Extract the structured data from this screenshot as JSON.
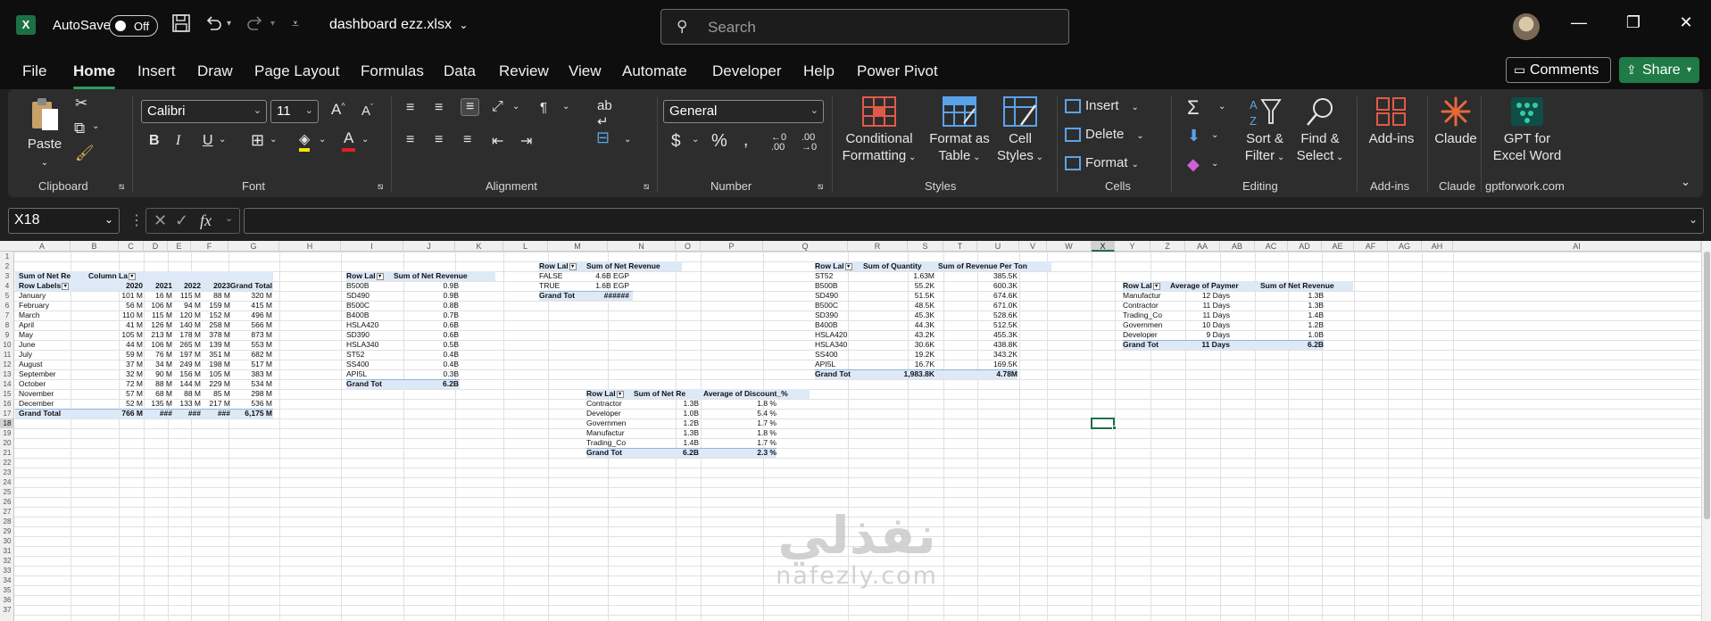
{
  "titlebar": {
    "app_icon": "excel-icon",
    "autosave_label": "AutoSave",
    "autosave_state": "Off",
    "file_name": "dashboard ezz.xlsx",
    "search_placeholder": "Search"
  },
  "menu": {
    "items": [
      "File",
      "Home",
      "Insert",
      "Draw",
      "Page Layout",
      "Formulas",
      "Data",
      "Review",
      "View",
      "Automate",
      "Developer",
      "Help",
      "Power Pivot"
    ],
    "active": "Home",
    "comments_label": "Comments",
    "share_label": "Share"
  },
  "ribbon": {
    "clipboard": {
      "paste": "Paste",
      "label": "Clipboard"
    },
    "font": {
      "name": "Calibri",
      "size": "11",
      "label": "Font"
    },
    "alignment": {
      "label": "Alignment"
    },
    "number": {
      "format": "General",
      "label": "Number"
    },
    "styles": {
      "conditional": [
        "Conditional",
        "Formatting"
      ],
      "format_table": [
        "Format as",
        "Table"
      ],
      "cell_styles": [
        "Cell",
        "Styles"
      ],
      "label": "Styles"
    },
    "cells": {
      "insert": "Insert",
      "delete": "Delete",
      "format": "Format",
      "label": "Cells"
    },
    "editing": {
      "sort": [
        "Sort &",
        "Filter"
      ],
      "find": [
        "Find &",
        "Select"
      ],
      "label": "Editing"
    },
    "addins": {
      "btn": "Add-ins",
      "label": "Add-ins"
    },
    "claude": {
      "btn": "Claude",
      "label": "Claude"
    },
    "gpt": {
      "btn": [
        "GPT for",
        "Excel Word"
      ],
      "label": "gptforwork.com"
    }
  },
  "formula_bar": {
    "name_box": "X18",
    "fx": "fx",
    "formula": ""
  },
  "sheet": {
    "columns": [
      "A",
      "B",
      "C",
      "D",
      "E",
      "F",
      "G",
      "H",
      "I",
      "J",
      "K",
      "L",
      "M",
      "N",
      "O",
      "P",
      "Q",
      "R",
      "S",
      "T",
      "U",
      "V",
      "W",
      "X",
      "Y",
      "Z",
      "AA",
      "AB",
      "AC",
      "AD",
      "AE",
      "AF",
      "AG",
      "AH",
      "AI"
    ],
    "selected_column": "X",
    "selected_row": 18,
    "row_count": 37,
    "pivot1": {
      "corner": "Sum of Net Re",
      "col_labels": "Column La",
      "row_labels": "Row Labels",
      "years": [
        "2020",
        "2021",
        "2022",
        "2023",
        "Grand Total"
      ],
      "rows": [
        [
          "January",
          "101 M",
          "16 M",
          "115 M",
          "88 M",
          "320 M"
        ],
        [
          "February",
          "56 M",
          "106 M",
          "94 M",
          "159 M",
          "415 M"
        ],
        [
          "March",
          "110 M",
          "115 M",
          "120 M",
          "152 M",
          "496 M"
        ],
        [
          "April",
          "41 M",
          "126 M",
          "140 M",
          "258 M",
          "566 M"
        ],
        [
          "May",
          "105 M",
          "213 M",
          "178 M",
          "378 M",
          "873 M"
        ],
        [
          "June",
          "44 M",
          "106 M",
          "265 M",
          "139 M",
          "553 M"
        ],
        [
          "July",
          "59 M",
          "76 M",
          "197 M",
          "351 M",
          "682 M"
        ],
        [
          "August",
          "37 M",
          "34 M",
          "249 M",
          "198 M",
          "517 M"
        ],
        [
          "September",
          "32 M",
          "90 M",
          "156 M",
          "105 M",
          "383 M"
        ],
        [
          "October",
          "72 M",
          "88 M",
          "144 M",
          "229 M",
          "534 M"
        ],
        [
          "November",
          "57 M",
          "68 M",
          "88 M",
          "85 M",
          "298 M"
        ],
        [
          "December",
          "52 M",
          "135 M",
          "133 M",
          "217 M",
          "536 M"
        ]
      ],
      "total": [
        "Grand Total",
        "766 M",
        "###",
        "###",
        "###",
        "6,175 M"
      ]
    },
    "pivot2": {
      "headers": [
        "Row Lal",
        "Sum of Net Revenue"
      ],
      "rows": [
        [
          "B500B",
          "0.9B"
        ],
        [
          "SD490",
          "0.9B"
        ],
        [
          "B500C",
          "0.8B"
        ],
        [
          "B400B",
          "0.7B"
        ],
        [
          "HSLA420",
          "0.6B"
        ],
        [
          "SD390",
          "0.6B"
        ],
        [
          "HSLA340",
          "0.5B"
        ],
        [
          "ST52",
          "0.4B"
        ],
        [
          "SS400",
          "0.4B"
        ],
        [
          "API5L",
          "0.3B"
        ]
      ],
      "total": [
        "Grand Tot",
        "6.2B"
      ]
    },
    "pivot3": {
      "headers": [
        "Row Lal",
        "Sum of Net Revenue"
      ],
      "rows": [
        [
          "FALSE",
          "4.6B EGP"
        ],
        [
          "TRUE",
          "1.6B EGP"
        ]
      ],
      "total": [
        "Grand Tot",
        "######"
      ]
    },
    "pivot4": {
      "headers": [
        "Row Lal",
        "Sum of Net Re",
        "Average of Discount_%"
      ],
      "rows": [
        [
          "Contractor",
          "1.3B",
          "1.8 %"
        ],
        [
          "Developer",
          "1.0B",
          "5.4 %"
        ],
        [
          "Governmen",
          "1.2B",
          "1.7 %"
        ],
        [
          "Manufactur",
          "1.3B",
          "1.8 %"
        ],
        [
          "Trading_Co",
          "1.4B",
          "1.7 %"
        ]
      ],
      "total": [
        "Grand Tot",
        "6.2B",
        "2.3 %"
      ]
    },
    "pivot5": {
      "headers": [
        "Row Lal",
        "Sum of Quantity",
        "Sum of Revenue Per Ton"
      ],
      "rows": [
        [
          "ST52",
          "1.63M",
          "385.5K"
        ],
        [
          "B500B",
          "55.2K",
          "600.3K"
        ],
        [
          "SD490",
          "51.5K",
          "674.6K"
        ],
        [
          "B500C",
          "48.5K",
          "671.0K"
        ],
        [
          "SD390",
          "45.3K",
          "528.6K"
        ],
        [
          "B400B",
          "44.3K",
          "512.5K"
        ],
        [
          "HSLA420",
          "43.2K",
          "455.3K"
        ],
        [
          "HSLA340",
          "30.6K",
          "438.8K"
        ],
        [
          "SS400",
          "19.2K",
          "343.2K"
        ],
        [
          "API5L",
          "16.7K",
          "169.5K"
        ]
      ],
      "total": [
        "Grand Tot",
        "1,983.8K",
        "4.78M"
      ]
    },
    "pivot6": {
      "headers": [
        "Row Lal",
        "Average of Paymer",
        "Sum of Net Revenue"
      ],
      "rows": [
        [
          "Manufactur",
          "12 Days",
          "1.3B"
        ],
        [
          "Contractor",
          "11 Days",
          "1.3B"
        ],
        [
          "Trading_Co",
          "11 Days",
          "1.4B"
        ],
        [
          "Governmen",
          "10 Days",
          "1.2B"
        ],
        [
          "Developer",
          "9 Days",
          "1.0B"
        ]
      ],
      "total": [
        "Grand Tot",
        "11 Days",
        "6.2B"
      ]
    },
    "watermark": {
      "arabic": "نفذلي",
      "latin": "nafezly.com"
    }
  }
}
